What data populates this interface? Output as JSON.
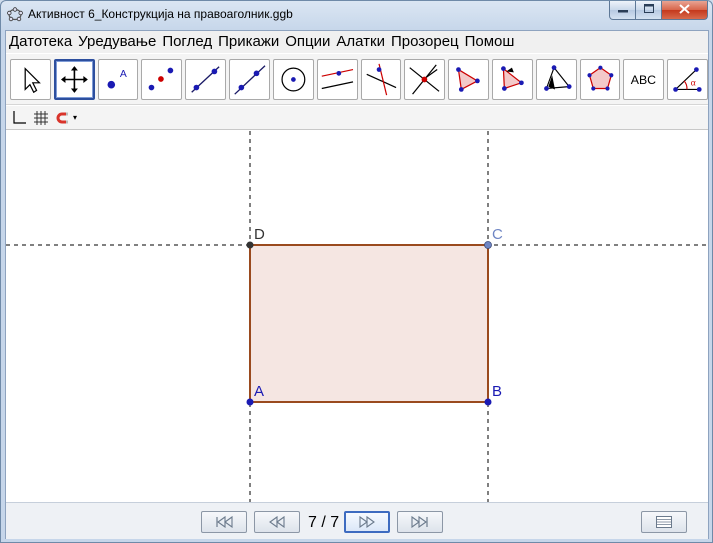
{
  "window": {
    "title": "Активност 6_Конструкција на правоаголник.ggb",
    "minimize_glyph": "▬",
    "maximize_glyph": "□",
    "close_glyph": "✕"
  },
  "menu": {
    "items": [
      "Датотека",
      "Уредување",
      "Поглед",
      "Прикажи",
      "Опции",
      "Алатки",
      "Прозорец",
      "Помош"
    ]
  },
  "toolbar": {
    "tools": [
      {
        "icon": "move-arrow-icon"
      },
      {
        "icon": "move-graphics-view-icon",
        "selected": true
      },
      {
        "icon": "new-point-icon"
      },
      {
        "icon": "midpoint-icon"
      },
      {
        "icon": "line-through-two-points-icon"
      },
      {
        "icon": "perpendicular-line-icon"
      },
      {
        "icon": "circle-with-center-icon"
      },
      {
        "icon": "parallel-line-icon"
      },
      {
        "icon": "perpendicular-bisector-icon"
      },
      {
        "icon": "intersect-icon"
      },
      {
        "icon": "polygon-icon"
      },
      {
        "icon": "angle-icon"
      },
      {
        "icon": "reflect-icon"
      },
      {
        "icon": "regular-polygon-icon"
      },
      {
        "icon": "text-icon",
        "label": "ABC"
      },
      {
        "icon": "angle-measure-icon",
        "label": "α"
      }
    ]
  },
  "stylebar": {
    "dropdown_glyph": "▾"
  },
  "graphics": {
    "points": {
      "A": {
        "label": "A",
        "color": "#1a1ab3"
      },
      "B": {
        "label": "B",
        "color": "#1a1ab3"
      },
      "C": {
        "label": "C",
        "color": "#6f86c4"
      },
      "D": {
        "label": "D",
        "color": "#333333"
      }
    },
    "rectangle": {
      "fill": "#f5e6e2",
      "stroke": "#9a4a1e"
    }
  },
  "navigation": {
    "step_current": "7",
    "step_separator": "/",
    "step_total": "7"
  }
}
